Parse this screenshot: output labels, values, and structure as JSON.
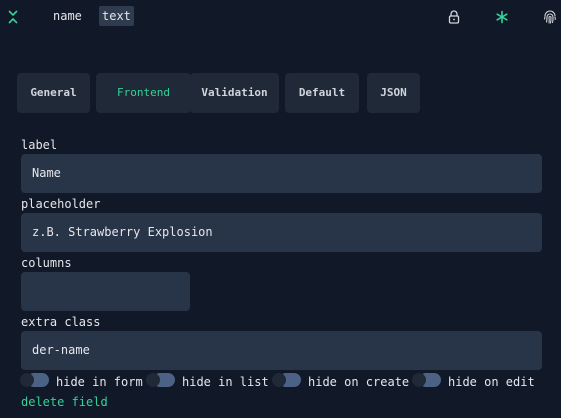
{
  "header": {
    "field_name": "name",
    "field_type": "text",
    "icons": [
      "chevrons-collapse-icon",
      "lock-icon",
      "asterisk-icon",
      "fingerprint-icon"
    ]
  },
  "tabs": [
    {
      "label": "General",
      "active": false
    },
    {
      "label": "Frontend",
      "active": true
    },
    {
      "label": "Validation",
      "active": false
    },
    {
      "label": "Default",
      "active": false
    },
    {
      "label": "JSON",
      "active": false
    }
  ],
  "form": {
    "label": {
      "label": "label",
      "value": "Name"
    },
    "placeholder": {
      "label": "placeholder",
      "value": "z.B. Strawberry Explosion"
    },
    "columns": {
      "label": "columns",
      "value": ""
    },
    "extra_class": {
      "label": "extra class",
      "value": "der-name"
    }
  },
  "toggles": [
    {
      "label": "hide in form",
      "on": false
    },
    {
      "label": "hide in list",
      "on": false
    },
    {
      "label": "hide on create",
      "on": false
    },
    {
      "label": "hide on edit",
      "on": false
    }
  ],
  "delete_label": "delete field",
  "colors": {
    "background": "#111827",
    "accent": "#34d399",
    "input_bg": "#283447",
    "tab_bg": "#1f2937"
  }
}
